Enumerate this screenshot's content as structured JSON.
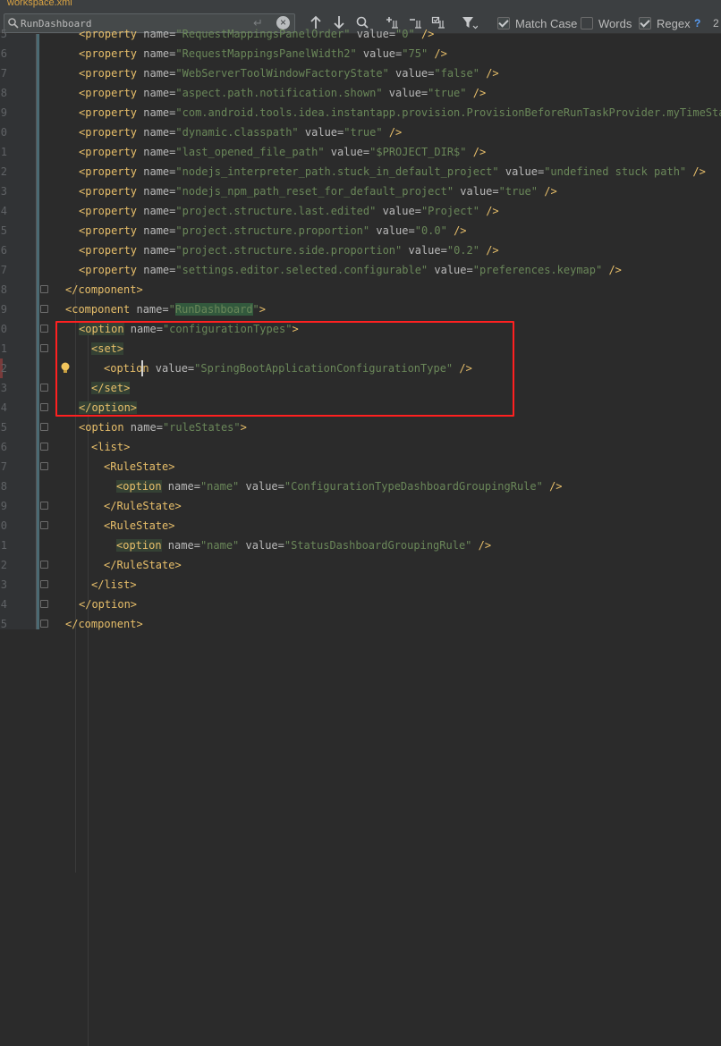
{
  "file_tab": {
    "label": "workspace.xml"
  },
  "find_bar": {
    "search_value": "RunDashboard",
    "options": [
      {
        "label": "Match Case",
        "checked": true
      },
      {
        "label": "Words",
        "checked": false
      },
      {
        "label": "Regex",
        "checked": true
      }
    ],
    "help": "?",
    "match_count": "2"
  },
  "editor": {
    "lines": [
      {
        "num": "5",
        "segments": [
          {
            "t": "<property",
            "c": "t"
          },
          {
            "t": " name=",
            "c": "a"
          },
          {
            "t": "\"RequestMappingsPanelOrder\"",
            "c": "v"
          },
          {
            "t": " value=",
            "c": "a"
          },
          {
            "t": "\"0\"",
            "c": "v"
          },
          {
            "t": " />",
            "c": "t"
          }
        ]
      },
      {
        "num": "6",
        "segments": [
          {
            "t": "<property",
            "c": "t"
          },
          {
            "t": " name=",
            "c": "a"
          },
          {
            "t": "\"RequestMappingsPanelWidth2\"",
            "c": "v"
          },
          {
            "t": " value=",
            "c": "a"
          },
          {
            "t": "\"75\"",
            "c": "v"
          },
          {
            "t": " />",
            "c": "t"
          }
        ]
      },
      {
        "num": "7",
        "segments": [
          {
            "t": "<property",
            "c": "t"
          },
          {
            "t": " name=",
            "c": "a"
          },
          {
            "t": "\"WebServerToolWindowFactoryState\"",
            "c": "v"
          },
          {
            "t": " value=",
            "c": "a"
          },
          {
            "t": "\"false\"",
            "c": "v"
          },
          {
            "t": " />",
            "c": "t"
          }
        ]
      },
      {
        "num": "8",
        "segments": [
          {
            "t": "<property",
            "c": "t"
          },
          {
            "t": " name=",
            "c": "a"
          },
          {
            "t": "\"aspect.path.notification.shown\"",
            "c": "v"
          },
          {
            "t": " value=",
            "c": "a"
          },
          {
            "t": "\"true\"",
            "c": "v"
          },
          {
            "t": " />",
            "c": "t"
          }
        ]
      },
      {
        "num": "9",
        "segments": [
          {
            "t": "<property",
            "c": "t"
          },
          {
            "t": " name=",
            "c": "a"
          },
          {
            "t": "\"com.android.tools.idea.instantapp.provision.ProvisionBeforeRunTaskProvider.myTimeStamp\"",
            "c": "v"
          }
        ]
      },
      {
        "num": "0",
        "segments": [
          {
            "t": "<property",
            "c": "t"
          },
          {
            "t": " name=",
            "c": "a"
          },
          {
            "t": "\"dynamic.classpath\"",
            "c": "v"
          },
          {
            "t": " value=",
            "c": "a"
          },
          {
            "t": "\"true\"",
            "c": "v"
          },
          {
            "t": " />",
            "c": "t"
          }
        ]
      },
      {
        "num": "1",
        "segments": [
          {
            "t": "<property",
            "c": "t"
          },
          {
            "t": " name=",
            "c": "a"
          },
          {
            "t": "\"last_opened_file_path\"",
            "c": "v"
          },
          {
            "t": " value=",
            "c": "a"
          },
          {
            "t": "\"$PROJECT_DIR$\"",
            "c": "v"
          },
          {
            "t": " />",
            "c": "t"
          }
        ]
      },
      {
        "num": "2",
        "segments": [
          {
            "t": "<property",
            "c": "t"
          },
          {
            "t": " name=",
            "c": "a"
          },
          {
            "t": "\"nodejs_interpreter_path.stuck_in_default_project\"",
            "c": "v"
          },
          {
            "t": " value=",
            "c": "a"
          },
          {
            "t": "\"undefined stuck path\"",
            "c": "v"
          },
          {
            "t": " />",
            "c": "t"
          }
        ]
      },
      {
        "num": "3",
        "segments": [
          {
            "t": "<property",
            "c": "t"
          },
          {
            "t": " name=",
            "c": "a"
          },
          {
            "t": "\"nodejs_npm_path_reset_for_default_project\"",
            "c": "v"
          },
          {
            "t": " value=",
            "c": "a"
          },
          {
            "t": "\"true\"",
            "c": "v"
          },
          {
            "t": " />",
            "c": "t"
          }
        ]
      },
      {
        "num": "4",
        "segments": [
          {
            "t": "<property",
            "c": "t"
          },
          {
            "t": " name=",
            "c": "a"
          },
          {
            "t": "\"project.structure.last.edited\"",
            "c": "v"
          },
          {
            "t": " value=",
            "c": "a"
          },
          {
            "t": "\"Project\"",
            "c": "v"
          },
          {
            "t": " />",
            "c": "t"
          }
        ]
      },
      {
        "num": "5",
        "segments": [
          {
            "t": "<property",
            "c": "t"
          },
          {
            "t": " name=",
            "c": "a"
          },
          {
            "t": "\"project.structure.proportion\"",
            "c": "v"
          },
          {
            "t": " value=",
            "c": "a"
          },
          {
            "t": "\"0.0\"",
            "c": "v"
          },
          {
            "t": " />",
            "c": "t"
          }
        ]
      },
      {
        "num": "6",
        "segments": [
          {
            "t": "<property",
            "c": "t"
          },
          {
            "t": " name=",
            "c": "a"
          },
          {
            "t": "\"project.structure.side.proportion\"",
            "c": "v"
          },
          {
            "t": " value=",
            "c": "a"
          },
          {
            "t": "\"0.2\"",
            "c": "v"
          },
          {
            "t": " />",
            "c": "t"
          }
        ]
      },
      {
        "num": "7",
        "segments": [
          {
            "t": "<property",
            "c": "t"
          },
          {
            "t": " name=",
            "c": "a"
          },
          {
            "t": "\"settings.editor.selected.configurable\"",
            "c": "v"
          },
          {
            "t": " value=",
            "c": "a"
          },
          {
            "t": "\"preferences.keymap\"",
            "c": "v"
          },
          {
            "t": " />",
            "c": "t"
          }
        ]
      },
      {
        "num": "8",
        "segments": [
          {
            "t": "</component>",
            "c": "t"
          }
        ]
      },
      {
        "num": "9",
        "segments": [
          {
            "t": "<component",
            "c": "t"
          },
          {
            "t": " name=",
            "c": "a"
          },
          {
            "t": "\"",
            "c": "v"
          },
          {
            "t": "RunDashboard",
            "c": "v match"
          },
          {
            "t": "\"",
            "c": "v"
          },
          {
            "t": ">",
            "c": "t"
          }
        ]
      },
      {
        "num": "0",
        "segments": [
          {
            "t": "<option",
            "c": "t hl"
          },
          {
            "t": " name=",
            "c": "a"
          },
          {
            "t": "\"configurationTypes\"",
            "c": "v"
          },
          {
            "t": ">",
            "c": "t"
          }
        ]
      },
      {
        "num": "1",
        "segments": [
          {
            "t": "<set>",
            "c": "t hl"
          }
        ]
      },
      {
        "num": "2",
        "segments": [
          {
            "t": "<option",
            "c": "t"
          },
          {
            "t": " value=",
            "c": "a"
          },
          {
            "t": "\"SpringBootApplicationConfigurationType\"",
            "c": "v"
          },
          {
            "t": " />",
            "c": "t"
          }
        ]
      },
      {
        "num": "3",
        "segments": [
          {
            "t": "</set>",
            "c": "t hl"
          }
        ]
      },
      {
        "num": "4",
        "segments": [
          {
            "t": "</option>",
            "c": "t hl"
          }
        ]
      },
      {
        "num": "5",
        "segments": [
          {
            "t": "<option",
            "c": "t"
          },
          {
            "t": " name=",
            "c": "a"
          },
          {
            "t": "\"ruleStates\"",
            "c": "v"
          },
          {
            "t": ">",
            "c": "t"
          }
        ]
      },
      {
        "num": "6",
        "segments": [
          {
            "t": "<list>",
            "c": "t"
          }
        ]
      },
      {
        "num": "7",
        "segments": [
          {
            "t": "<RuleState>",
            "c": "t"
          }
        ]
      },
      {
        "num": "8",
        "segments": [
          {
            "t": "<option",
            "c": "t hl"
          },
          {
            "t": " name=",
            "c": "a"
          },
          {
            "t": "\"name\"",
            "c": "v"
          },
          {
            "t": " value=",
            "c": "a"
          },
          {
            "t": "\"ConfigurationTypeDashboardGroupingRule\"",
            "c": "v"
          },
          {
            "t": " />",
            "c": "t"
          }
        ]
      },
      {
        "num": "9",
        "segments": [
          {
            "t": "</RuleState>",
            "c": "t"
          }
        ]
      },
      {
        "num": "0",
        "segments": [
          {
            "t": "<RuleState>",
            "c": "t"
          }
        ]
      },
      {
        "num": "1",
        "segments": [
          {
            "t": "<option",
            "c": "t hl"
          },
          {
            "t": " name=",
            "c": "a"
          },
          {
            "t": "\"name\"",
            "c": "v"
          },
          {
            "t": " value=",
            "c": "a"
          },
          {
            "t": "\"StatusDashboardGroupingRule\"",
            "c": "v"
          },
          {
            "t": " />",
            "c": "t"
          }
        ]
      },
      {
        "num": "2",
        "segments": [
          {
            "t": "</RuleState>",
            "c": "t"
          }
        ]
      },
      {
        "num": "3",
        "segments": [
          {
            "t": "</list>",
            "c": "t"
          }
        ]
      },
      {
        "num": "4",
        "segments": [
          {
            "t": "</option>",
            "c": "t"
          }
        ]
      },
      {
        "num": "5",
        "segments": [
          {
            "t": "</component>",
            "c": "t"
          }
        ]
      }
    ]
  }
}
